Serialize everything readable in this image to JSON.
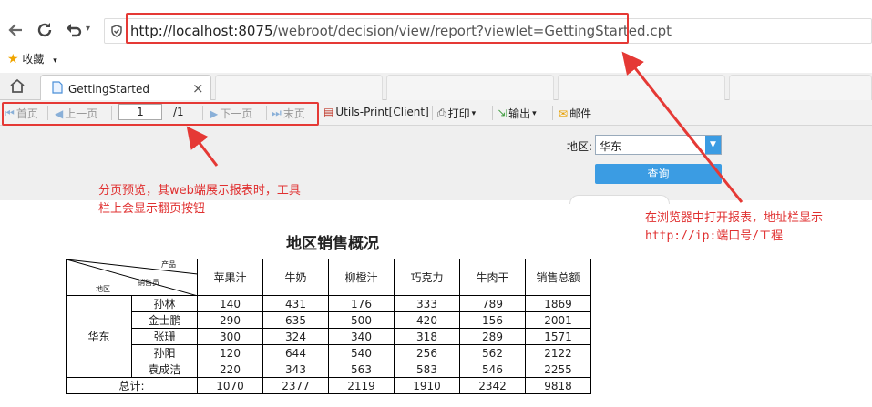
{
  "browser": {
    "url_host": "http://localhost:8075",
    "url_path": "/webroot/decision/view/report?viewlet=GettingStarted.cpt",
    "bookmarks_label": "收藏",
    "tab_title": "GettingStarted",
    "close_glyph": "×",
    "menu_glyph": "▾"
  },
  "toolbar": {
    "first": "首页",
    "prev": "上一页",
    "page_value": "1",
    "page_total": "/1",
    "next": "下一页",
    "last": "末页",
    "utils_print": "Utils-Print[Client]",
    "print": "打印",
    "export": "输出",
    "mail": "邮件"
  },
  "params": {
    "region_label": "地区:",
    "region_value": "华东",
    "query_button": "查询"
  },
  "report": {
    "title": "地区销售概况",
    "corner_top": "产品",
    "corner_mid": "销售员",
    "corner_bottom": "地区",
    "columns": [
      "苹果汁",
      "牛奶",
      "柳橙汁",
      "巧克力",
      "牛肉干",
      "销售总额"
    ],
    "region": "华东",
    "rows": [
      {
        "name": "孙林",
        "values": [
          "140",
          "431",
          "176",
          "333",
          "789",
          "1869"
        ]
      },
      {
        "name": "金士鹏",
        "values": [
          "290",
          "635",
          "500",
          "420",
          "156",
          "2001"
        ]
      },
      {
        "name": "张珊",
        "values": [
          "300",
          "324",
          "340",
          "318",
          "289",
          "1571"
        ]
      },
      {
        "name": "孙阳",
        "values": [
          "120",
          "644",
          "540",
          "256",
          "562",
          "2122"
        ]
      },
      {
        "name": "袁成洁",
        "values": [
          "220",
          "343",
          "563",
          "583",
          "546",
          "2255"
        ]
      }
    ],
    "total_label": "总计:",
    "totals": [
      "1070",
      "2377",
      "2119",
      "1910",
      "2342",
      "9818"
    ]
  },
  "annotations": {
    "left_line1": "分页预览，其web端展示报表时，工具",
    "left_line2": "栏上会显示翻页按钮",
    "right_line1": "在浏览器中打开报表，地址栏显示",
    "right_line2": "http://ip:端口号/工程"
  },
  "colors": {
    "annotation": "#e53935",
    "query_button": "#3b9ce3"
  }
}
